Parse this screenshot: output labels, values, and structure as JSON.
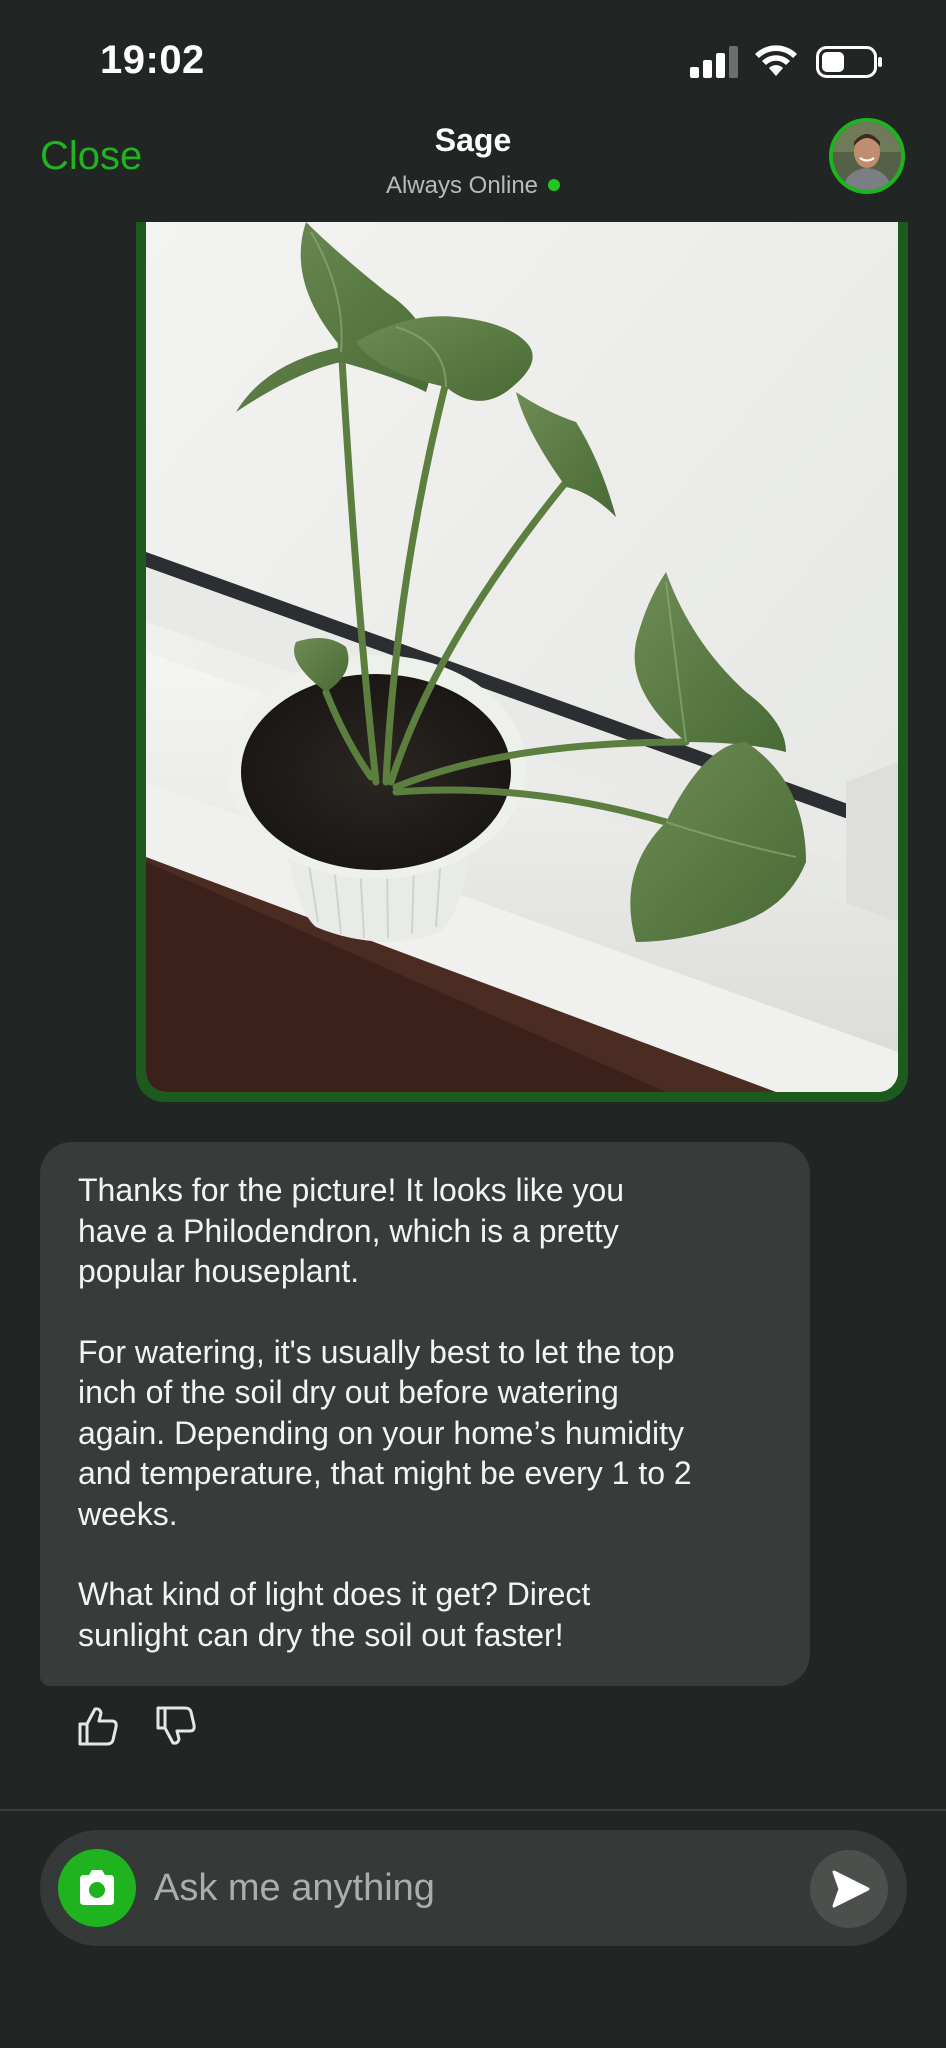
{
  "status_bar": {
    "time": "19:02",
    "icons": [
      "cellular-signal-icon",
      "wifi-icon",
      "battery-icon"
    ]
  },
  "header": {
    "close_label": "Close",
    "title": "Sage",
    "subtitle": "Always Online",
    "online_color": "#22c521",
    "avatar_icon": "assistant-avatar"
  },
  "conversation": {
    "user_image": {
      "description_icon": "plant-photo",
      "bubble_color": "#1d5a1e"
    },
    "assistant_message": {
      "paragraphs": [
        "Thanks for the picture! It looks like you\nhave a Philodendron, which is a pretty\npopular houseplant.",
        "For watering, it's usually best to let the top\ninch of the soil dry out before watering\nagain. Depending on your home’s humidity\nand temperature, that might be every 1 to 2\nweeks.",
        "What kind of light does it get? Direct\nsunlight can dry the soil out faster!"
      ]
    },
    "feedback": {
      "like_icon": "thumbs-up-icon",
      "dislike_icon": "thumbs-down-icon"
    }
  },
  "composer": {
    "placeholder": "Ask me anything",
    "camera_icon": "camera-icon",
    "send_icon": "send-icon"
  },
  "colors": {
    "background": "#212624",
    "accent": "#22b321",
    "bubble": "#373b39"
  }
}
